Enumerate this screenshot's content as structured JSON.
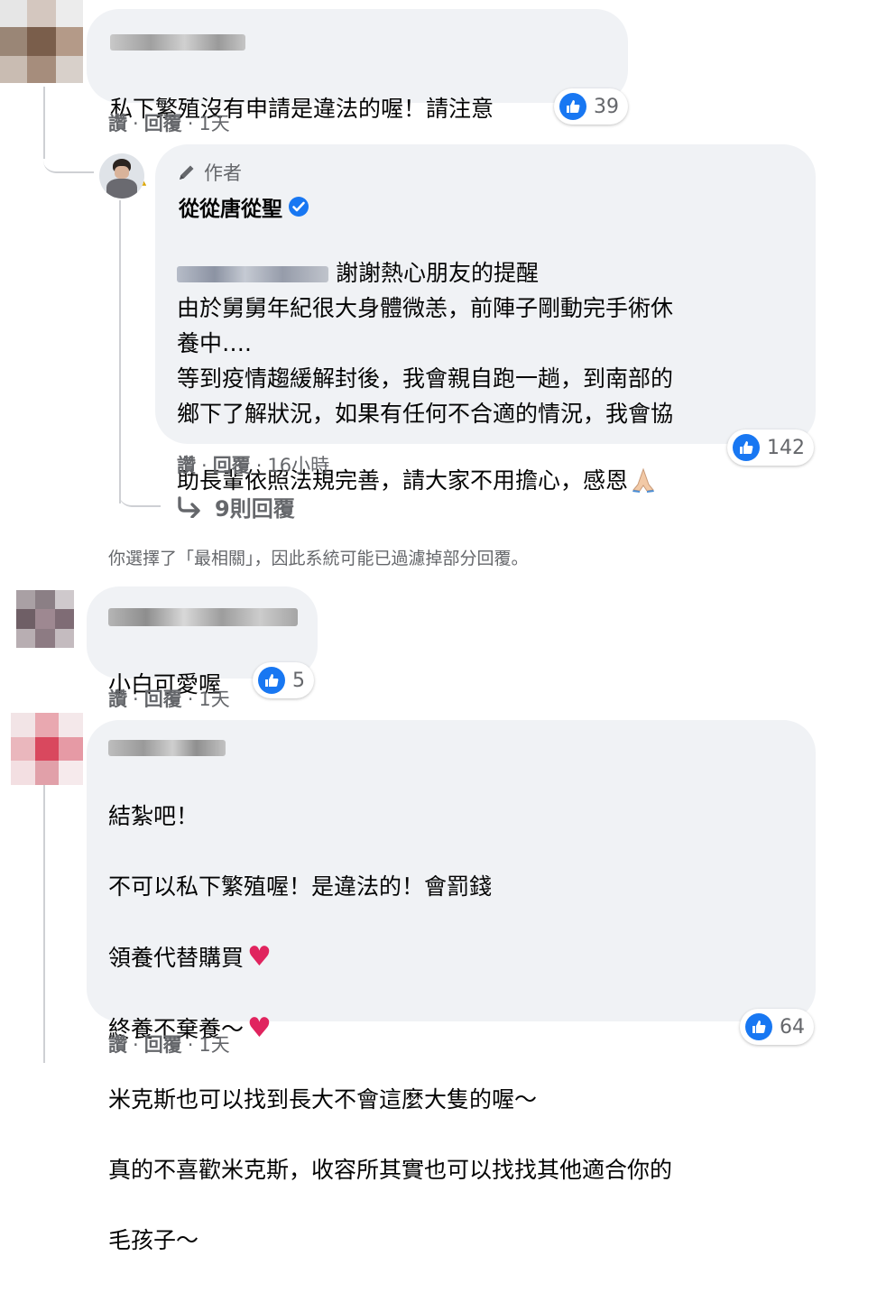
{
  "comments": [
    {
      "text": "私下繁殖沒有申請是違法的喔！請注意",
      "emoji": "⚠",
      "like_label": "讚",
      "reply_label": "回覆",
      "time": "1天",
      "likes": "39"
    },
    {
      "text": "小白可愛喔",
      "like_label": "讚",
      "reply_label": "回覆",
      "time": "1天",
      "likes": "5"
    },
    {
      "lines": [
        "結紮吧！",
        "不可以私下繁殖喔！是違法的！會罰錢",
        "領養代替購買",
        "終養不棄養～",
        "米克斯也可以找到長大不會這麼大隻的喔～",
        "真的不喜歡米克斯，收容所其實也可以找找其他適合你的",
        "毛孩子～"
      ],
      "heart": "♥",
      "like_label": "讚",
      "reply_label": "回覆",
      "time": "1天",
      "likes": "64"
    }
  ],
  "reply": {
    "author_badge": "作者",
    "author_name": "從從唐從聖",
    "mention_suffix": "謝謝熱心朋友的提醒",
    "body": "由於舅舅年紀很大身體微恙，前陣子剛動完手術休\n養中….\n等到疫情趨緩解封後，我會親自跑一趟，到南部的\n鄉下了解狀況，如果有任何不合適的情況，我會協\n助長輩依照法規完善，請大家不用擔心，感恩",
    "like_label": "讚",
    "reply_label": "回覆",
    "time": "16小時",
    "likes": "142",
    "more_replies": "9則回覆"
  },
  "filter_notice": "你選擇了「最相關」，因此系統可能已過濾掉部分回覆。",
  "colors": {
    "like_blue": "#1877f2",
    "bubble": "#f0f2f5",
    "meta": "#65676b",
    "heart": "#e0245e"
  },
  "icons": [
    "pen-icon",
    "verified-icon",
    "thumbs-up-icon",
    "reply-arrow-icon",
    "warning-icon",
    "pray-icon",
    "heart-icon"
  ]
}
